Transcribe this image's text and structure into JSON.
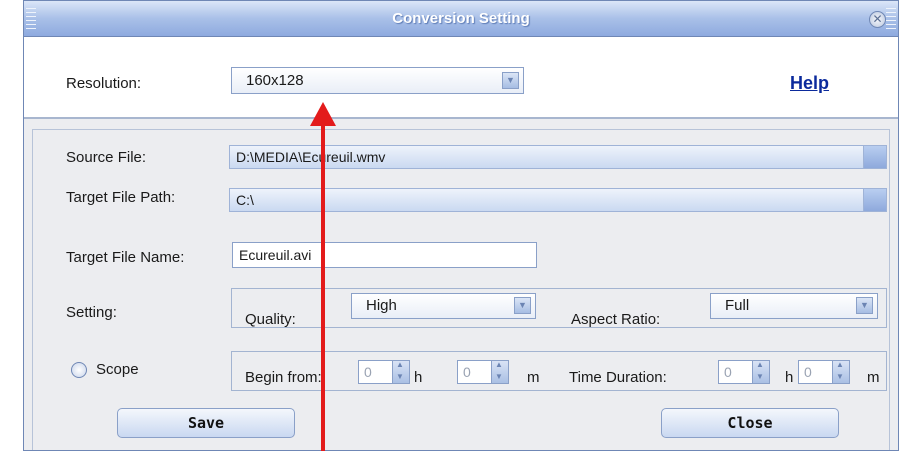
{
  "window": {
    "title": "Conversion Setting",
    "close_glyph": "✕"
  },
  "resolution": {
    "label": "Resolution:",
    "value": "160x128"
  },
  "help": {
    "label": "Help"
  },
  "source_file": {
    "label": "Source File:",
    "value": "D:\\MEDIA\\Ecureuil.wmv"
  },
  "target_path": {
    "label": "Target File Path:",
    "value": "C:\\"
  },
  "target_name": {
    "label": "Target File Name:",
    "value": "Ecureuil.avi"
  },
  "setting": {
    "label": "Setting:",
    "quality_label": "Quality:",
    "quality_value": "High",
    "aspect_label": "Aspect Ratio:",
    "aspect_value": "Full"
  },
  "scope": {
    "label": "Scope",
    "begin_label": "Begin from:",
    "begin_h": "0",
    "h_unit": "h",
    "begin_m": "0",
    "m_unit": "m",
    "duration_label": "Time Duration:",
    "duration_h": "0",
    "duration_m": "0"
  },
  "buttons": {
    "save": "Save",
    "close": "Close"
  },
  "colors": {
    "accent": "#0b2a9c",
    "annotation_arrow": "#e31b1b",
    "title_bar": "#a9c0e8"
  }
}
